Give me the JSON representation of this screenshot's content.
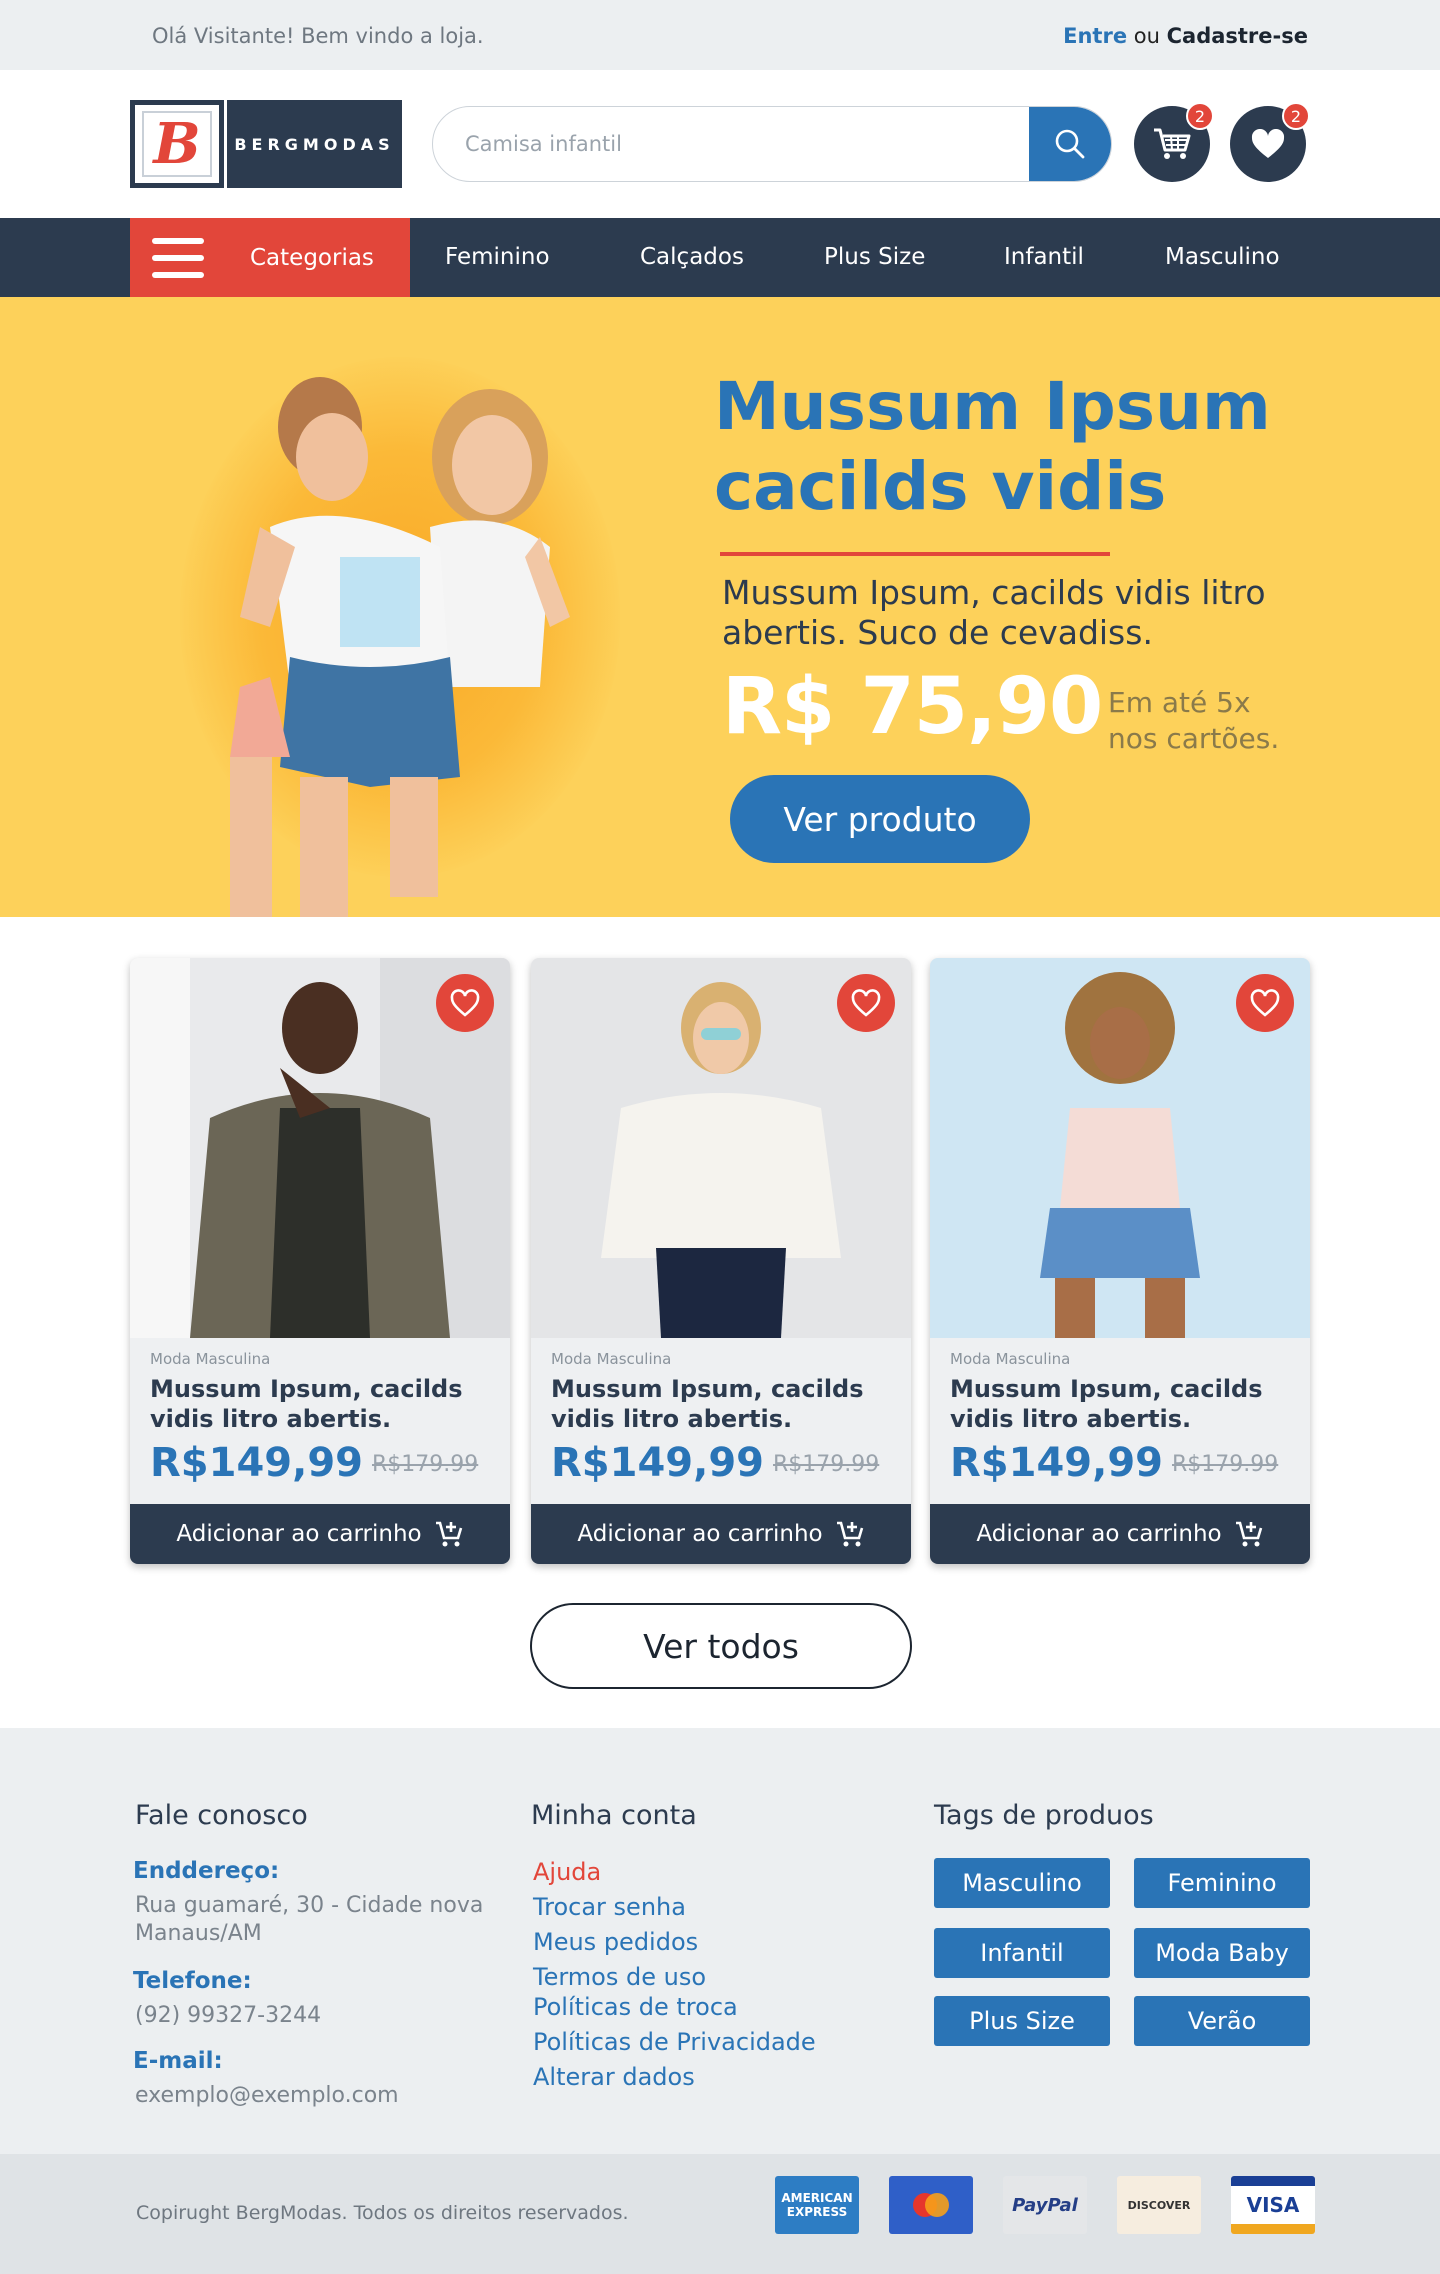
{
  "topbar": {
    "greeting": "Olá Visitante! Bem vindo a loja.",
    "login": "Entre",
    "or": "ou",
    "signup": "Cadastre-se"
  },
  "header": {
    "logo_letter": "B",
    "logo_text": "BERGMODAS",
    "search_placeholder": "Camisa infantil",
    "cart_count": "2",
    "wishlist_count": "2"
  },
  "nav": {
    "categories_label": "Categorias",
    "items": [
      "Feminino",
      "Calçados",
      "Plus Size",
      "Infantil",
      "Masculino"
    ]
  },
  "hero": {
    "title": "Mussum Ipsum cacilds vidis",
    "subtitle": "Mussum Ipsum, cacilds vidis litro abertis. Suco de cevadiss.",
    "price": "R$ 75,90",
    "installments": "Em até 5x nos cartões.",
    "cta": "Ver produto"
  },
  "products": [
    {
      "category": "Moda Masculina",
      "title": "Mussum Ipsum, cacilds vidis litro abertis.",
      "price": "R$149,99",
      "old_price": "R$179.99",
      "add_label": "Adicionar ao carrinho"
    },
    {
      "category": "Moda Masculina",
      "title": "Mussum Ipsum, cacilds vidis litro abertis.",
      "price": "R$149,99",
      "old_price": "R$179.99",
      "add_label": "Adicionar ao carrinho"
    },
    {
      "category": "Moda Masculina",
      "title": "Mussum Ipsum, cacilds vidis litro abertis.",
      "price": "R$149,99",
      "old_price": "R$179.99",
      "add_label": "Adicionar ao carrinho"
    }
  ],
  "see_all": "Ver todos",
  "footer": {
    "contact": {
      "heading": "Fale conosco",
      "address_label": "Enddereço:",
      "address_line1": "Rua guamaré, 30 - Cidade nova",
      "address_line2": "Manaus/AM",
      "phone_label": "Telefone:",
      "phone": "(92) 99327-3244",
      "email_label": "E-mail:",
      "email": "exemplo@exemplo.com"
    },
    "account": {
      "heading": "Minha conta",
      "links": [
        "Ajuda",
        "Trocar senha",
        "Meus pedidos",
        "Termos de uso",
        "Políticas de troca",
        "Políticas de Privacidade",
        "Alterar dados"
      ]
    },
    "tags": {
      "heading": "Tags de produos",
      "items": [
        "Masculino",
        "Feminino",
        "Infantil",
        "Moda Baby",
        "Plus Size",
        "Verão"
      ]
    },
    "copyright": "Copirught BergModas. Todos os direitos reservados.",
    "payments": [
      "AMERICAN EXPRESS",
      "mastercard",
      "PayPal",
      "DISCOVER",
      "VISA"
    ]
  },
  "colors": {
    "primary_blue": "#2a74b6",
    "accent_red": "#e2463a",
    "navy": "#2c3b4f",
    "hero_yellow": "#fdd15a",
    "light_gray": "#eceff1"
  },
  "icons": [
    "search-icon",
    "cart-icon",
    "heart-icon",
    "menu-icon",
    "add-to-cart-icon"
  ]
}
